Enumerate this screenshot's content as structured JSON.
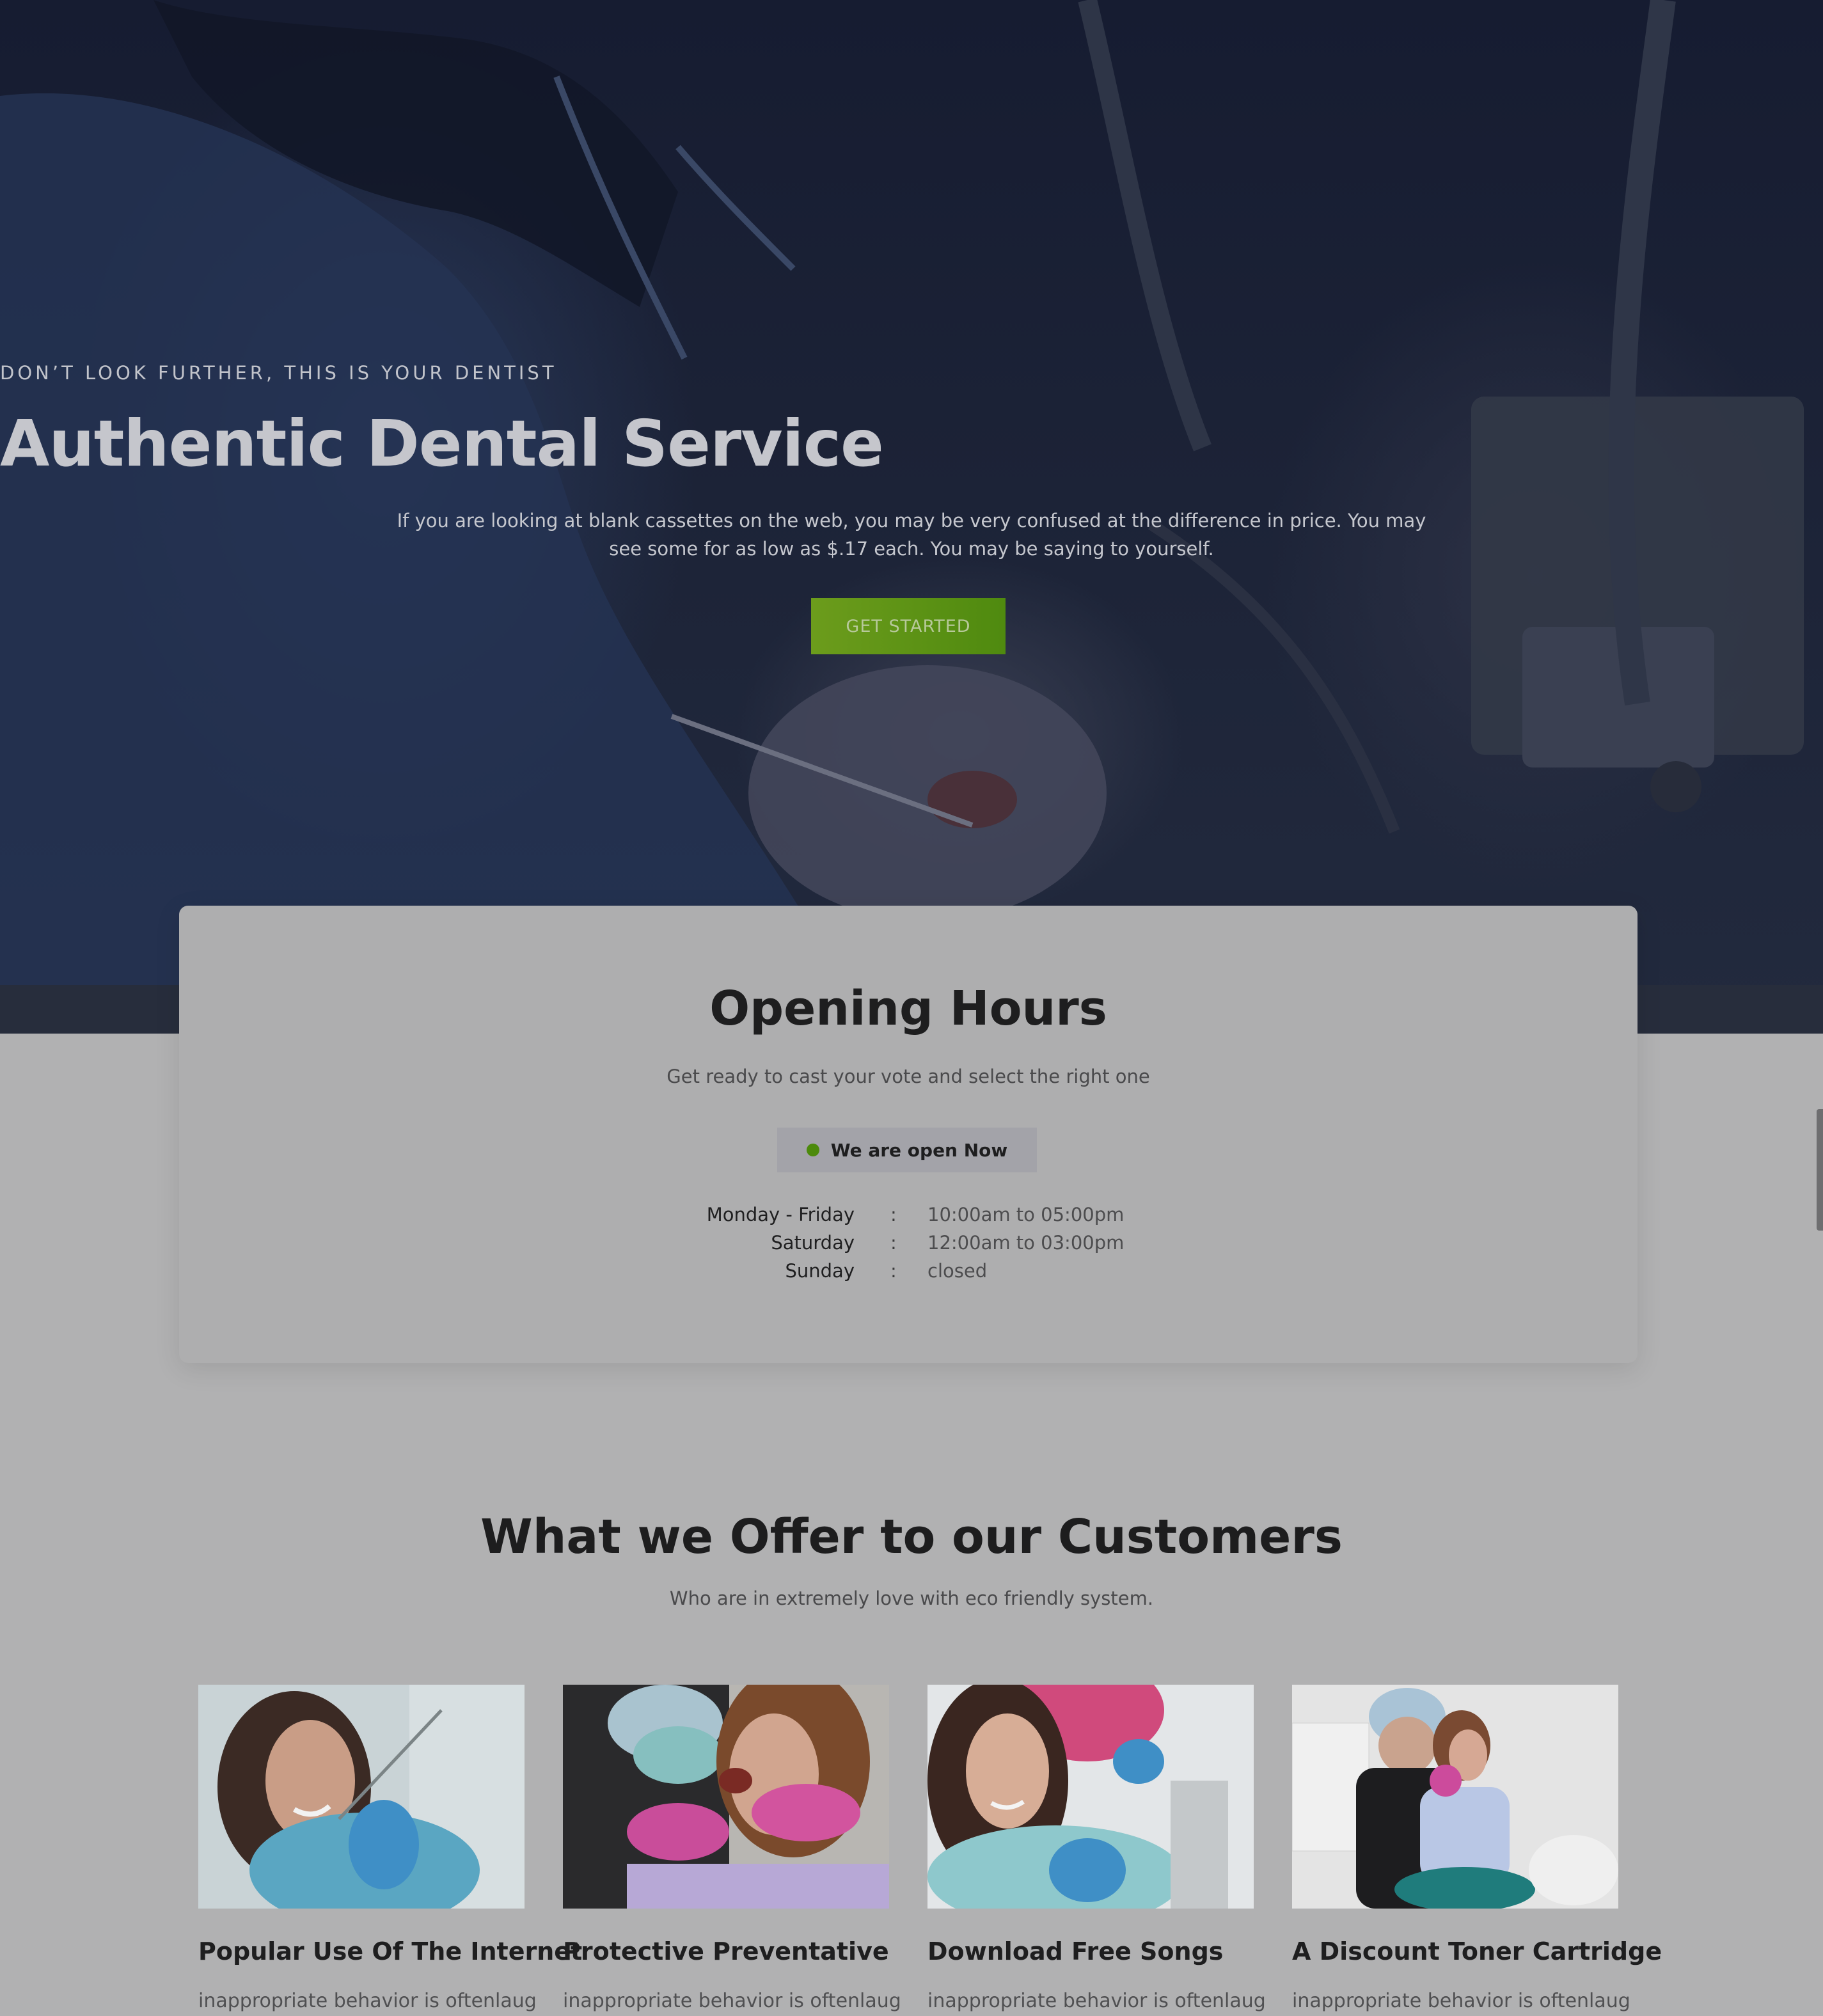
{
  "hero": {
    "eyebrow": "DON’T LOOK FURTHER, THIS IS YOUR DENTIST",
    "title": "Authentic Dental Service",
    "text": "If you are looking at blank cassettes on the web, you may be very confused at the difference in price. You may see some for as low as $.17 each. You may be saying to yourself.",
    "cta_label": "GET STARTED"
  },
  "hours": {
    "title": "Opening Hours",
    "subtitle": "Get ready to cast your vote and select the right one",
    "status": "We are open Now",
    "rows": [
      {
        "day": "Monday - Friday",
        "sep": ":",
        "time": "10:00am to 05:00pm"
      },
      {
        "day": "Saturday",
        "sep": ":",
        "time": "12:00am to 03:00pm"
      },
      {
        "day": "Sunday",
        "sep": ":",
        "time": "closed"
      }
    ]
  },
  "offer": {
    "title": "What we Offer to our Customers",
    "subtitle": "Who are in extremely love with eco friendly system.",
    "cards": [
      {
        "title": "Popular Use Of The Internet",
        "text": "inappropriate behavior is oftenlaug"
      },
      {
        "title": "Protective Preventative",
        "text": "inappropriate behavior is oftenlaug"
      },
      {
        "title": "Download Free Songs",
        "text": "inappropriate behavior is oftenlaug"
      },
      {
        "title": "A Discount Toner Cartridge",
        "text": "inappropriate behavior is oftenlaug"
      }
    ]
  },
  "colors": {
    "accent": "#4c8a0b",
    "hero_overlay": "#1a2036",
    "page_background": "#b1b1b2"
  }
}
